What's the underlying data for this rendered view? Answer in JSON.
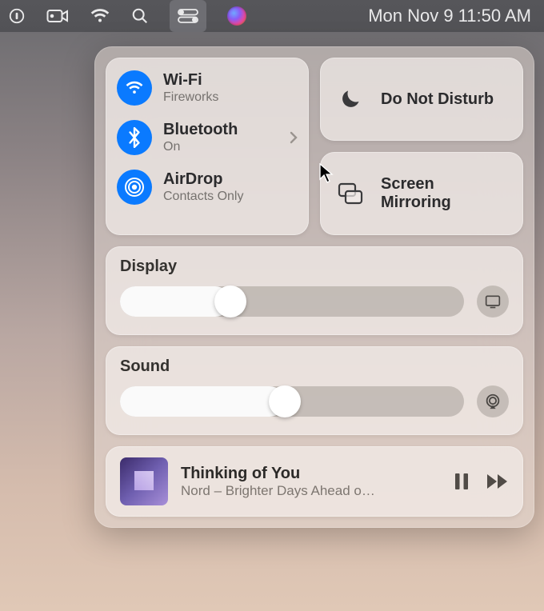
{
  "menubar": {
    "datetime": "Mon Nov 9  11:50 AM"
  },
  "connectivity": {
    "wifi": {
      "title": "Wi-Fi",
      "subtitle": "Fireworks"
    },
    "bluetooth": {
      "title": "Bluetooth",
      "subtitle": "On"
    },
    "airdrop": {
      "title": "AirDrop",
      "subtitle": "Contacts Only"
    }
  },
  "tiles": {
    "dnd": {
      "label": "Do Not Disturb"
    },
    "mirror": {
      "label": "Screen Mirroring"
    }
  },
  "display": {
    "heading": "Display",
    "value_percent": 32
  },
  "sound": {
    "heading": "Sound",
    "value_percent": 48
  },
  "now_playing": {
    "title": "Thinking of You",
    "subtitle": "Nord – Brighter Days Ahead o…"
  }
}
